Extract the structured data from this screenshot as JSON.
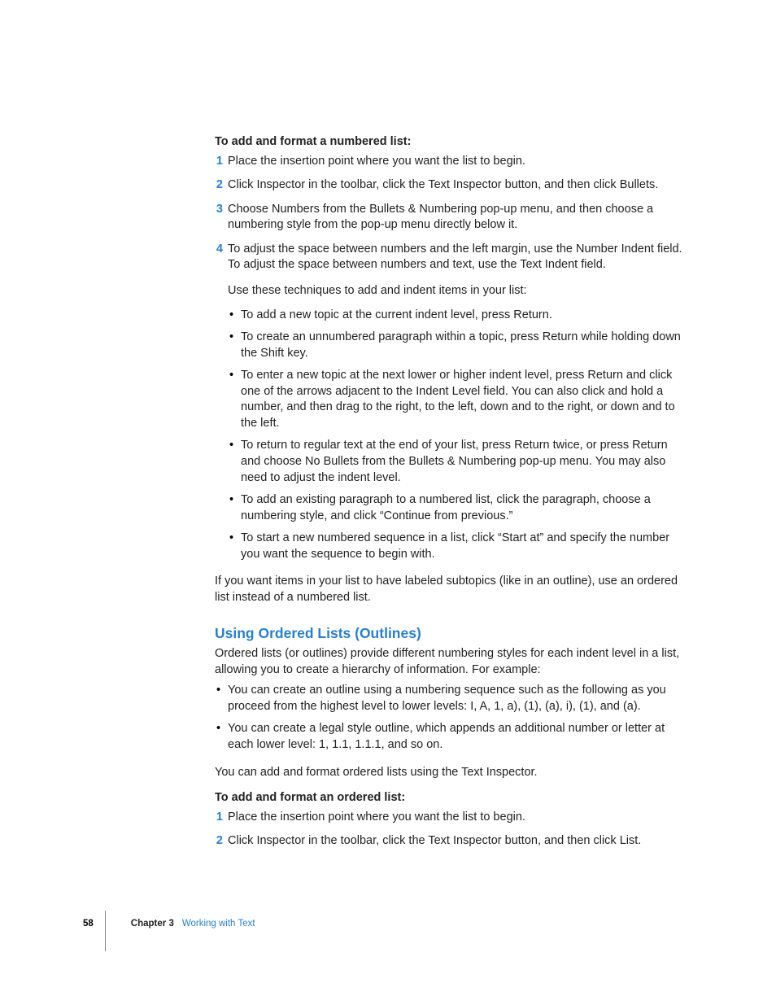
{
  "section1": {
    "intro": "To add and format a numbered list:",
    "steps": [
      "Place the insertion point where you want the list to begin.",
      "Click Inspector in the toolbar, click the Text Inspector button, and then click Bullets.",
      "Choose Numbers from the Bullets & Numbering pop-up menu, and then choose a numbering style from the pop-up menu directly below it.",
      "To adjust the space between numbers and the left margin, use the Number Indent field. To adjust the space between numbers and text, use the Text Indent field."
    ],
    "techniques_lead": "Use these techniques to add and indent items in your list:",
    "techniques": [
      "To add a new topic at the current indent level, press Return.",
      "To create an unnumbered paragraph within a topic, press Return while holding down the Shift key.",
      "To enter a new topic at the next lower or higher indent level, press Return and click one of the arrows adjacent to the Indent Level field. You can also click and hold a number, and then drag to the right, to the left, down and to the right, or down and to the left.",
      "To return to regular text at the end of your list, press Return twice, or press Return and choose No Bullets from the Bullets & Numbering pop-up menu. You may also need to adjust the indent level.",
      "To add an existing paragraph to a numbered list, click the paragraph, choose a numbering style, and click “Continue from previous.”",
      "To start a new numbered sequence in a list, click “Start at” and specify the number you want the sequence to begin with."
    ],
    "closing": "If you want items in your list to have labeled subtopics (like in an outline), use an ordered list instead of a numbered list."
  },
  "section2": {
    "heading": "Using Ordered Lists (Outlines)",
    "intro": "Ordered lists (or outlines) provide different numbering styles for each indent level in a list, allowing you to create a hierarchy of information. For example:",
    "bullets": [
      "You can create an outline using a numbering sequence such as the following as you proceed from the highest level to lower levels:  I, A, 1, a), (1), (a), i), (1), and (a).",
      "You can create a legal style outline, which appends an additional number or letter at each lower level:  1, 1.1, 1.1.1, and so on."
    ],
    "body": "You can add and format ordered lists using the Text Inspector.",
    "steps_intro": "To add and format an ordered list:",
    "steps": [
      "Place the insertion point where you want the list to begin.",
      "Click Inspector in the toolbar, click the Text Inspector button, and then click List."
    ]
  },
  "footer": {
    "page": "58",
    "chapter_label": "Chapter 3",
    "chapter_title": "Working with Text"
  }
}
